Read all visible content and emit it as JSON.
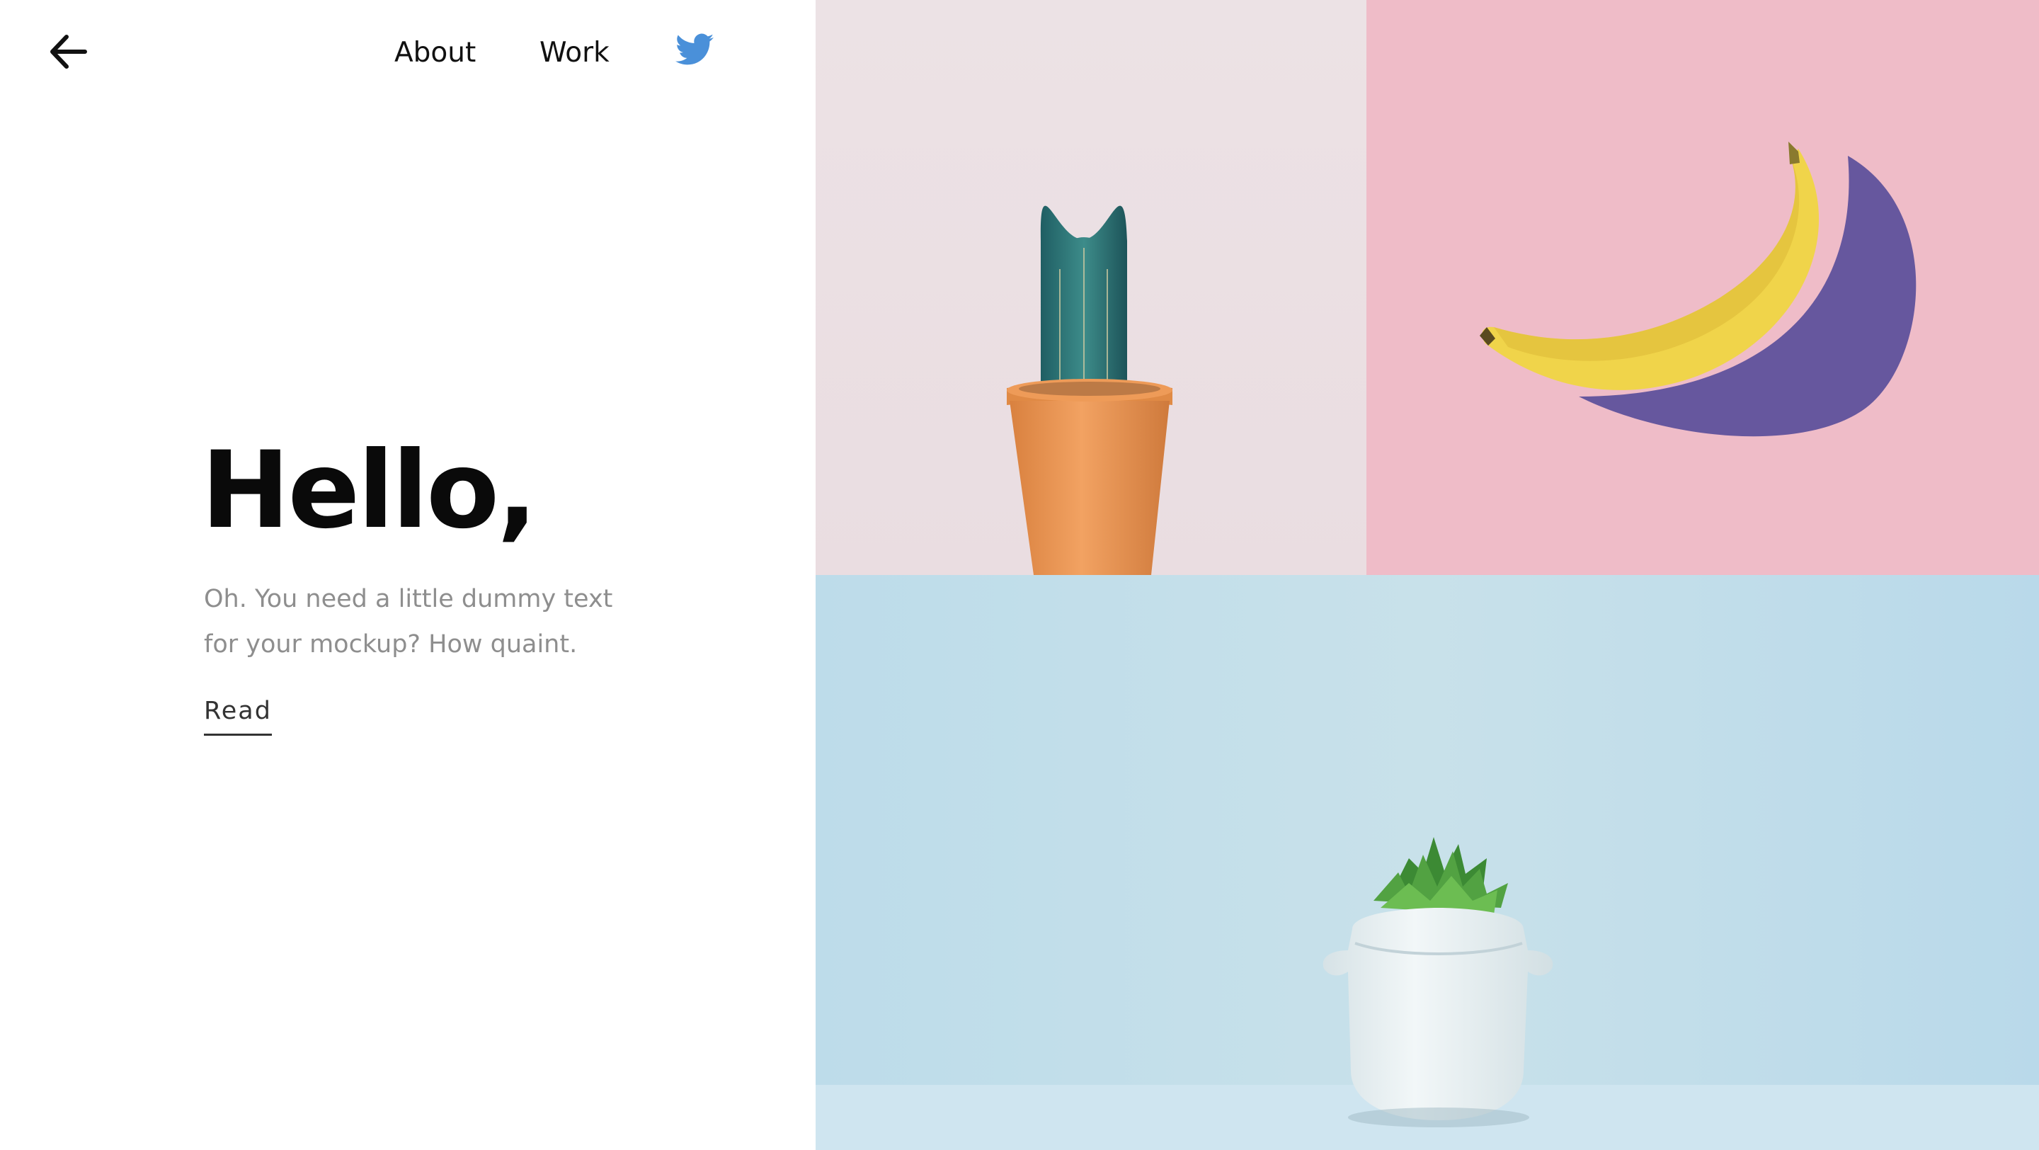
{
  "nav": {
    "back_icon": "arrow-left-icon",
    "about_label": "About",
    "work_label": "Work",
    "twitter_icon": "twitter-icon",
    "twitter_color": "#4a90d9"
  },
  "hero": {
    "title": "Hello,",
    "text": "Oh. You need a little dummy text for your mockup? How quaint.",
    "read_label": "Read"
  },
  "gallery": {
    "tiles": [
      {
        "name": "cactus-image",
        "background": "#ecdfe3"
      },
      {
        "name": "banana-image",
        "background": "#efbcc8"
      },
      {
        "name": "succulent-image",
        "background": "#c3dfea"
      }
    ]
  }
}
